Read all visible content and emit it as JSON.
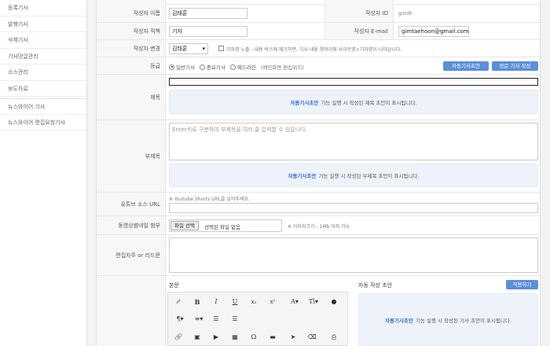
{
  "sidebar": {
    "items": [
      "등록기사",
      "발행기사",
      "삭제기사",
      "기사댓글관리",
      "소스관리",
      "보도자료",
      "뉴스와이어 기사",
      "뉴스와이어 편집요청기사"
    ]
  },
  "form": {
    "author_name_label": "작성자 이름",
    "author_name_value": "김태훈",
    "author_id_label": "작성자 ID",
    "author_id_value": "gimth",
    "author_title_label": "작성자 직책",
    "author_title_value": "기자",
    "author_email_label": "작성자 E-mail",
    "author_email_value": "gimtaehoon@gmail.com",
    "author_change_label": "작성자 변경",
    "author_select_value": "김태훈",
    "author_change_note": "기자명 노출 - 내용 박스에 체크하면, 기사 내용 첫머리에 사이트명+기자명이 나타납니다.",
    "grade_label": "등급",
    "grade_options": [
      "일반기사",
      "중요기사",
      "헤드라인"
    ],
    "grade_note": "(메인화면 편집위치)",
    "auto_draft_button": "자동기사초안",
    "long_article_button": "장문 기사 작성",
    "title_label": "제목",
    "title_hint_bold": "자동기사초안",
    "title_hint_text": "기능 실행 시 작성된 제목 초안이 표시됩니다.",
    "subtitle_label": "부제목",
    "subtitle_placeholder": "Enter키로 구분하여 부제목을 여러 줄 입력할 수 있습니다.",
    "subtitle_hint_bold": "자동기사초안",
    "subtitle_hint_text": "기능 실행 시 작성된 부제목 초안이 표시됩니다.",
    "youtube_label": "유튜브 소스 URL",
    "youtube_note": "※ Youtube Shorts URL을 넣어주세요.",
    "attach_label": "동영상썸네일 첨부",
    "file_button": "파일 선택",
    "file_none": "선택된 파일 없음",
    "attach_note": "※ 이미지크기 - 1Mb 이하 가능.",
    "editor_note_label": "편집자주 or 리드문",
    "body_label": "본문",
    "auto_draft_label": "자동 작성 초안",
    "apply_button": "적용하기",
    "body_hint_bold": "자동기사초안",
    "body_hint_text": "기능 실행 시 작성된 기사 초안이 표시됩니다."
  },
  "toolbar": {
    "row1": [
      "expand-icon",
      "B",
      "I",
      "U",
      "x₂",
      "x²",
      "A▾",
      "Tī▾",
      "drop-icon"
    ],
    "row2": [
      "¶▾",
      "≡▾",
      "indent-icon",
      "outdent-icon"
    ],
    "row3": [
      "link-icon",
      "image-icon",
      "video-icon",
      "table-icon",
      "Ω",
      "hr-icon",
      "select-icon",
      "eraser-icon",
      "print-icon"
    ]
  },
  "colors": {
    "accent": "#5b8fd9",
    "hint_bg": "#eef3fb",
    "hint_bold": "#2f6fd6"
  }
}
